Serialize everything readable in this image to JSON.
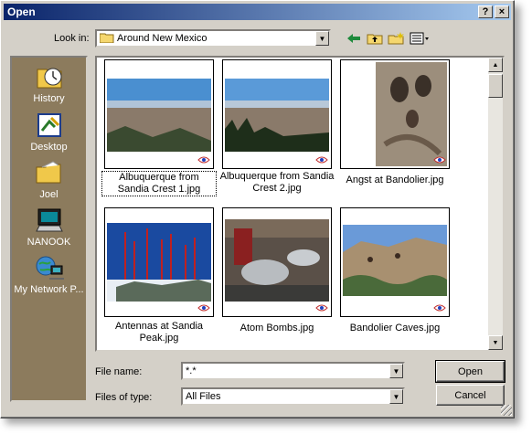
{
  "window": {
    "title": "Open",
    "help": "?",
    "close": "×"
  },
  "lookin": {
    "label": "Look in:",
    "value": "Around New Mexico"
  },
  "places": [
    {
      "label": "History"
    },
    {
      "label": "Desktop"
    },
    {
      "label": "Joel"
    },
    {
      "label": "NANOOK"
    },
    {
      "label": "My Network P..."
    }
  ],
  "files": [
    {
      "name": "Albuquerque from Sandia Crest 1.jpg"
    },
    {
      "name": "Albuquerque from Sandia Crest 2.jpg"
    },
    {
      "name": "Angst at Bandolier.jpg"
    },
    {
      "name": "Antennas at Sandia Peak.jpg"
    },
    {
      "name": "Atom Bombs.jpg"
    },
    {
      "name": "Bandolier Caves.jpg"
    }
  ],
  "filename": {
    "label": "File name:",
    "value": "*.*"
  },
  "filetype": {
    "label": "Files of type:",
    "value": "All Files"
  },
  "buttons": {
    "open": "Open",
    "cancel": "Cancel"
  }
}
